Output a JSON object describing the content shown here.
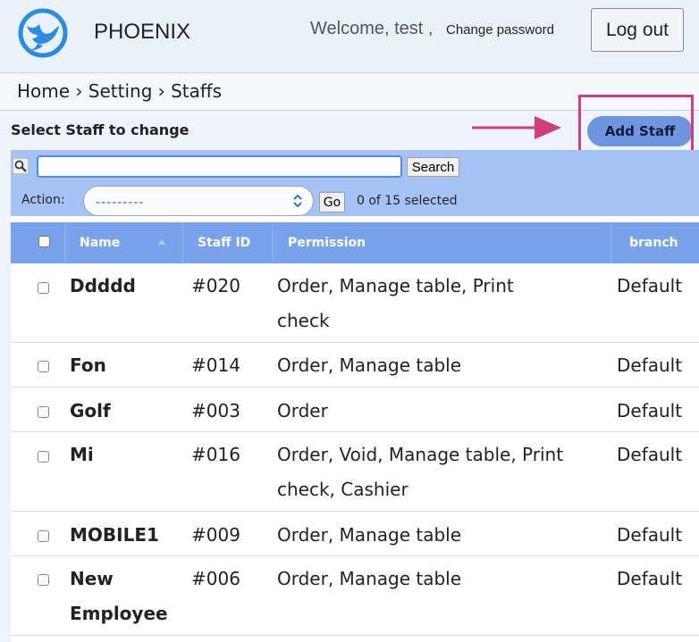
{
  "header": {
    "brand": "PHOENIX",
    "welcome": "Welcome, test ,",
    "change_password": "Change password",
    "logout_label": "Log out"
  },
  "breadcrumb": "Home › Setting › Staffs",
  "page": {
    "title": "Select Staff to change",
    "add_button": "Add Staff"
  },
  "toolbar": {
    "search_value": "",
    "search_button": "Search",
    "action_label": "Action:",
    "action_value": "---------",
    "go_button": "Go",
    "selected_count": "0 of 15 selected"
  },
  "table": {
    "columns": [
      "Name",
      "Staff ID",
      "Permission",
      "branch"
    ],
    "rows": [
      {
        "name": "Ddddd",
        "staff_id": "#020",
        "permission_1": "Order, Manage table, Print",
        "permission_2": "check",
        "branch": "Default"
      },
      {
        "name": "Fon",
        "staff_id": "#014",
        "permission_1": "Order, Manage table",
        "permission_2": "",
        "branch": "Default"
      },
      {
        "name": "Golf",
        "staff_id": "#003",
        "permission_1": "Order",
        "permission_2": "",
        "branch": "Default"
      },
      {
        "name": "Mi",
        "staff_id": "#016",
        "permission_1": "Order, Void, Manage table, Print",
        "permission_2": "check, Cashier",
        "branch": "Default"
      },
      {
        "name": "MOBILE1",
        "staff_id": "#009",
        "permission_1": "Order, Manage table",
        "permission_2": "",
        "branch": "Default"
      },
      {
        "name": "New",
        "name_2": "Employee",
        "staff_id": "#006",
        "permission_1": "Order, Manage table",
        "permission_2": "",
        "branch": "Default"
      }
    ]
  },
  "colors": {
    "accent": "#6d95e0",
    "toolbar": "#a6c3f6",
    "table_header": "#78a2ea",
    "highlight": "#d33d7b"
  },
  "icons": [
    "phoenix-logo-icon",
    "search-icon",
    "select-arrows-icon",
    "sort-asc-icon",
    "arrow-right-icon"
  ]
}
